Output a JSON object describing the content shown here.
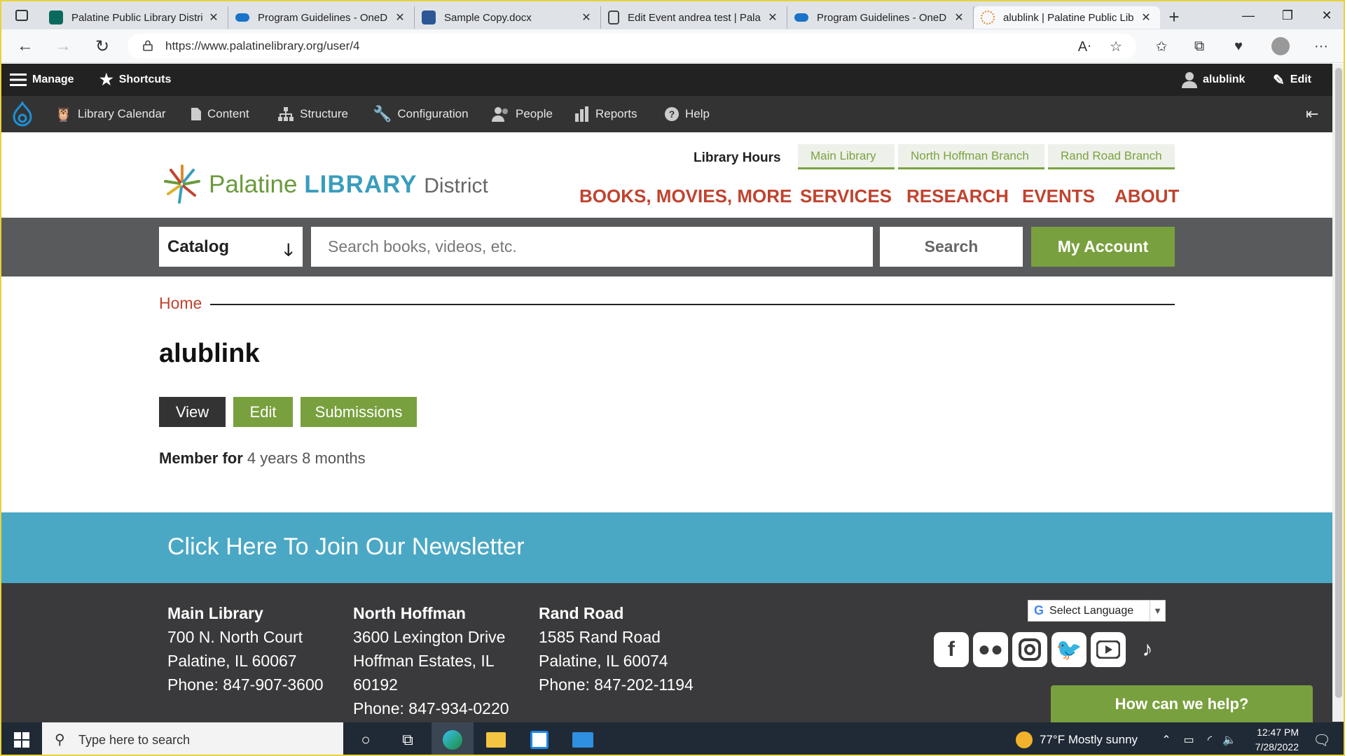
{
  "browser": {
    "tabs": [
      {
        "label": "Palatine Public Library Distri",
        "favicon_color": "#0b6a5e"
      },
      {
        "label": "Program Guidelines - OneD",
        "favicon_color": "#1a73c9"
      },
      {
        "label": "Sample Copy.docx",
        "favicon_color": "#2b5797"
      },
      {
        "label": "Edit Event andrea test | Pala",
        "favicon_color": "#ffffff"
      },
      {
        "label": "Program Guidelines - OneD",
        "favicon_color": "#1a73c9"
      },
      {
        "label": "alublink | Palatine Public Lib",
        "favicon_color": "#ffffff"
      }
    ],
    "url": "https://www.palatinelibrary.org/user/4"
  },
  "admin_toolbar": {
    "manage": "Manage",
    "shortcuts": "Shortcuts",
    "user": "alublink",
    "edit": "Edit",
    "menu": [
      "Library Calendar",
      "Content",
      "Structure",
      "Configuration",
      "People",
      "Reports",
      "Help"
    ]
  },
  "header": {
    "logo_text_1": "Palatine",
    "logo_text_2": "LIBRARY",
    "logo_text_3": "District",
    "hours_label": "Library Hours",
    "branches": [
      "Main Library",
      "North Hoffman Branch",
      "Rand Road Branch"
    ],
    "nav": [
      "BOOKS, MOVIES, MORE",
      "SERVICES",
      "RESEARCH",
      "EVENTS",
      "ABOUT"
    ]
  },
  "search": {
    "scope": "Catalog",
    "placeholder": "Search books, videos, etc.",
    "search_label": "Search",
    "account_label": "My Account"
  },
  "main": {
    "breadcrumb": "Home",
    "title": "alublink",
    "tabs": [
      "View",
      "Edit",
      "Submissions"
    ],
    "member_label": "Member for",
    "member_value": "4 years 8 months"
  },
  "newsletter": {
    "link": "Click Here To Join Our Newsletter"
  },
  "footer": {
    "locations": [
      {
        "name": "Main Library",
        "lines": [
          "700 N. North Court",
          "Palatine, IL 60067",
          "Phone: 847-907-3600"
        ]
      },
      {
        "name": "North Hoffman",
        "lines": [
          "3600 Lexington Drive",
          "Hoffman Estates, IL",
          "60192",
          "Phone: 847-934-0220"
        ]
      },
      {
        "name": "Rand Road",
        "lines": [
          "1585 Rand Road",
          "Palatine, IL 60074",
          "Phone: 847-202-1194"
        ]
      }
    ],
    "language": "Select Language",
    "help": "How can we help?"
  },
  "taskbar": {
    "search_placeholder": "Type here to search",
    "weather": "77°F  Mostly sunny",
    "time": "12:47 PM",
    "date": "7/28/2022"
  },
  "colors": {
    "brand_red": "#c0432f",
    "brand_green": "#79a03e",
    "brand_blue": "#4aa8c5",
    "footer_bg": "#3a3a3c"
  }
}
